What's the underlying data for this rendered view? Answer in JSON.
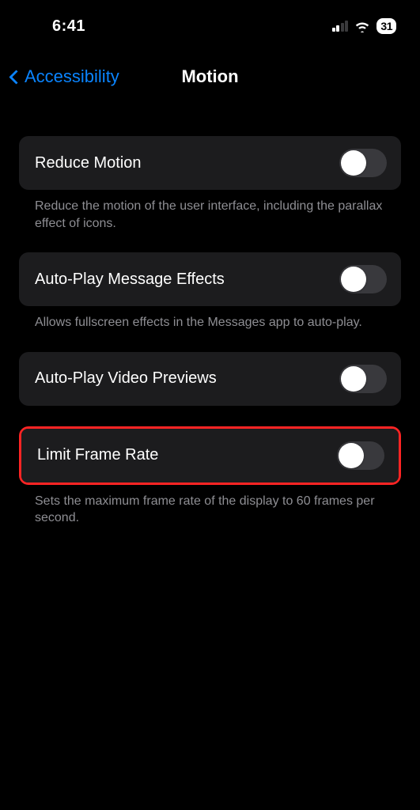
{
  "status": {
    "time": "6:41",
    "battery": "31"
  },
  "nav": {
    "back": "Accessibility",
    "title": "Motion"
  },
  "settings": {
    "reduce_motion": {
      "label": "Reduce Motion",
      "desc": "Reduce the motion of the user interface, including the parallax effect of icons."
    },
    "autoplay_msg": {
      "label": "Auto-Play Message Effects",
      "desc": "Allows fullscreen effects in the Messages app to auto-play."
    },
    "autoplay_video": {
      "label": "Auto-Play Video Previews"
    },
    "limit_frame": {
      "label": "Limit Frame Rate",
      "desc": "Sets the maximum frame rate of the display to 60 frames per second."
    }
  }
}
